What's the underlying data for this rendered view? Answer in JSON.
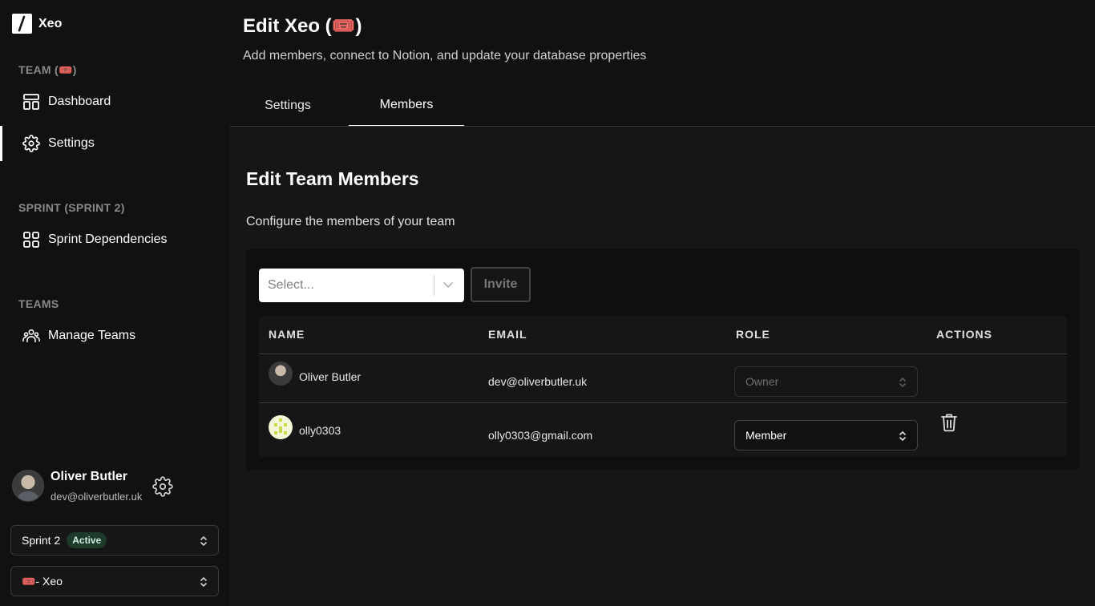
{
  "app": {
    "name": "Xeo"
  },
  "sidebar": {
    "team_label": "TEAM (🎟️)",
    "items_team": [
      {
        "label": "Dashboard",
        "icon": "dashboard-icon"
      },
      {
        "label": "Settings",
        "icon": "gear-icon",
        "active": true
      }
    ],
    "sprint_label": "SPRINT (SPRINT 2)",
    "items_sprint": [
      {
        "label": "Sprint Dependencies",
        "icon": "grid-icon"
      }
    ],
    "teams_label": "TEAMS",
    "items_teams": [
      {
        "label": "Manage Teams",
        "icon": "users-icon"
      }
    ],
    "user": {
      "name": "Oliver Butler",
      "email": "dev@oliverbutler.uk"
    },
    "sprint_select": {
      "value": "Sprint 2",
      "badge": "Active"
    },
    "team_select": {
      "value": "🎟️- Xeo"
    }
  },
  "header": {
    "title": "Edit Xeo (🎟️)",
    "subtitle": "Add members, connect to Notion, and update your database properties",
    "tabs": [
      {
        "label": "Settings",
        "active": false
      },
      {
        "label": "Members",
        "active": true
      }
    ]
  },
  "members": {
    "title": "Edit Team Members",
    "subtitle": "Configure the members of your team",
    "select_placeholder": "Select...",
    "invite_label": "Invite",
    "columns": [
      "NAME",
      "EMAIL",
      "ROLE",
      "ACTIONS"
    ],
    "rows": [
      {
        "name": "Oliver Butler",
        "email": "dev@oliverbutler.uk",
        "role": "Owner",
        "role_disabled": true,
        "deletable": false
      },
      {
        "name": "olly0303",
        "email": "olly0303@gmail.com",
        "role": "Member",
        "role_disabled": false,
        "deletable": true
      }
    ]
  },
  "colors": {
    "background": "#111111",
    "panel": "#0f0f0f",
    "badge_bg": "#1d3a2a"
  }
}
